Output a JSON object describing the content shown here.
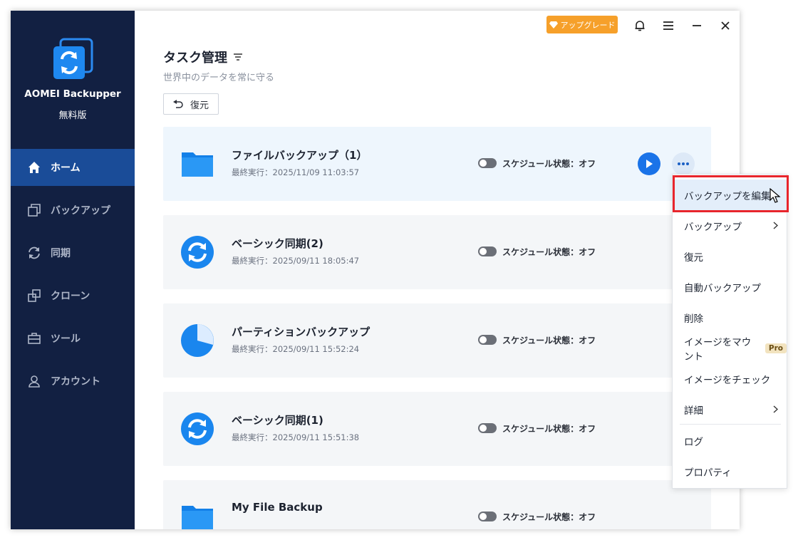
{
  "app": {
    "brand": "AOMEI Backupper",
    "edition": "無料版"
  },
  "topbar": {
    "upgrade_label": "アップグレード"
  },
  "sidebar": {
    "items": [
      {
        "label": "ホーム",
        "icon": "home-icon"
      },
      {
        "label": "バックアップ",
        "icon": "backup-icon"
      },
      {
        "label": "同期",
        "icon": "sync-icon"
      },
      {
        "label": "クローン",
        "icon": "clone-icon"
      },
      {
        "label": "ツール",
        "icon": "toolbox-icon"
      },
      {
        "label": "アカウント",
        "icon": "account-icon"
      }
    ]
  },
  "main": {
    "title": "タスク管理",
    "subtitle": "世界中のデータを常に守る",
    "restore_label": "復元"
  },
  "tasks": [
    {
      "name": "ファイルバックアップ（1）",
      "time": "最終実行：2025/11/09 11:03:57",
      "schedule": "スケジュール状態：オフ",
      "icon": "folder-icon"
    },
    {
      "name": "ベーシック同期(2)",
      "time": "最終実行：2025/09/11 18:05:47",
      "schedule": "スケジュール状態：オフ",
      "icon": "sync-circle-icon"
    },
    {
      "name": "パーティションバックアップ",
      "time": "最終実行：2025/09/11 15:52:24",
      "schedule": "スケジュール状態：オフ",
      "icon": "partition-icon"
    },
    {
      "name": "ベーシック同期(1)",
      "time": "最終実行：2025/09/11 15:51:38",
      "schedule": "スケジュール状態：オフ",
      "icon": "sync-circle-icon"
    },
    {
      "name": "My File Backup",
      "time": "",
      "schedule": "スケジュール状態：オフ",
      "icon": "folder-icon"
    }
  ],
  "context_menu": {
    "items": [
      {
        "label": "バックアップを編集"
      },
      {
        "label": "バックアップ"
      },
      {
        "label": "復元"
      },
      {
        "label": "自動バックアップ"
      },
      {
        "label": "削除"
      },
      {
        "label": "イメージをマウント",
        "badge": "Pro"
      },
      {
        "label": "イメージをチェック"
      },
      {
        "label": "詳細"
      },
      {
        "label": "ログ"
      },
      {
        "label": "プロパティ"
      }
    ]
  },
  "colors": {
    "sidebar_bg": "#122042",
    "accent": "#1a73e8",
    "upgrade": "#f6a02a",
    "highlight_outline": "#e8252c"
  }
}
